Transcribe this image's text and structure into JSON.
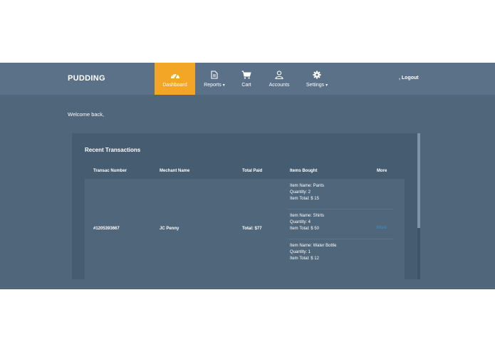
{
  "brand": "PUDDING",
  "nav": {
    "items": [
      {
        "label": "Dashboard",
        "icon": "dashboard-icon",
        "active": true
      },
      {
        "label": "Reports",
        "icon": "file-icon",
        "dropdown": true
      },
      {
        "label": "Cart",
        "icon": "cart-icon"
      },
      {
        "label": "Accounts",
        "icon": "user-icon"
      },
      {
        "label": "Settings",
        "icon": "gear-icon",
        "dropdown": true
      }
    ],
    "logout": ", Logout",
    "caret": "▾"
  },
  "welcome": "Welcome back,",
  "transactions": {
    "title": "Recent Transactions",
    "headers": [
      "Transac Number",
      "Mechant Name",
      "Total Paid",
      "Items Bought",
      "More"
    ],
    "row": {
      "number": "#1205393667",
      "merchant": "JC Penny",
      "total": "Total: $77",
      "more": "More",
      "items": [
        {
          "name": "Item Name: Pants",
          "qty": "Quantity: 2",
          "total": "Item Total: $ 15"
        },
        {
          "name": "Item Name: Shirts",
          "qty": "Quantity: 4",
          "total": "Item Total: $ 50"
        },
        {
          "name": "Item Name: Water Bottle",
          "qty": "Quantity: 1",
          "total": "Item Total: $ 12"
        }
      ]
    }
  },
  "colors": {
    "background": "#4f667b",
    "navbar": "#5a7187",
    "active": "#f3a625",
    "card": "#455c71",
    "link": "#3b8fd6"
  }
}
